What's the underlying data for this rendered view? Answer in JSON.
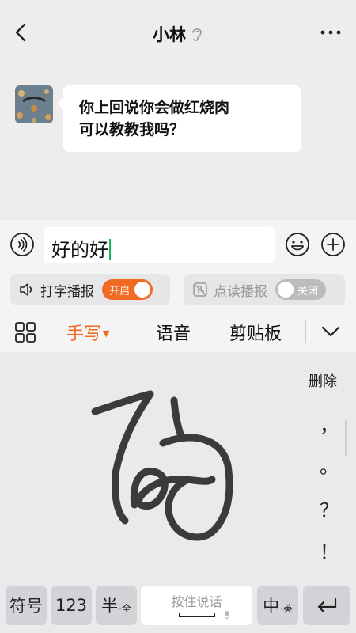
{
  "header": {
    "title": "小林",
    "back_icon": "chevron-left-icon",
    "mode_icon": "ear-icon",
    "more_icon": "more-dots-icon"
  },
  "chat": {
    "message_line1": "你上回说你会做红烧肉",
    "message_line2": "可以教教我吗？"
  },
  "input": {
    "value": "好的好"
  },
  "broadcast": {
    "typing_label": "打字播报",
    "typing_toggle": "开启",
    "reading_label": "点读播报",
    "reading_toggle": "关闭"
  },
  "toolbar": {
    "handwrite": "手写",
    "voice": "语音",
    "clipboard": "剪贴板"
  },
  "pad": {
    "delete": "删除",
    "comma": "，",
    "period": "。",
    "question": "？",
    "exclaim": "！"
  },
  "keys": {
    "symbol": "符号",
    "num": "123",
    "half": "半",
    "half_sub": "全",
    "space": "按住说话",
    "cn": "中",
    "cn_sub": "英"
  },
  "colors": {
    "accent": "#f16a22",
    "caret": "#14b85a",
    "toggle_off": "#bcbcbc"
  }
}
